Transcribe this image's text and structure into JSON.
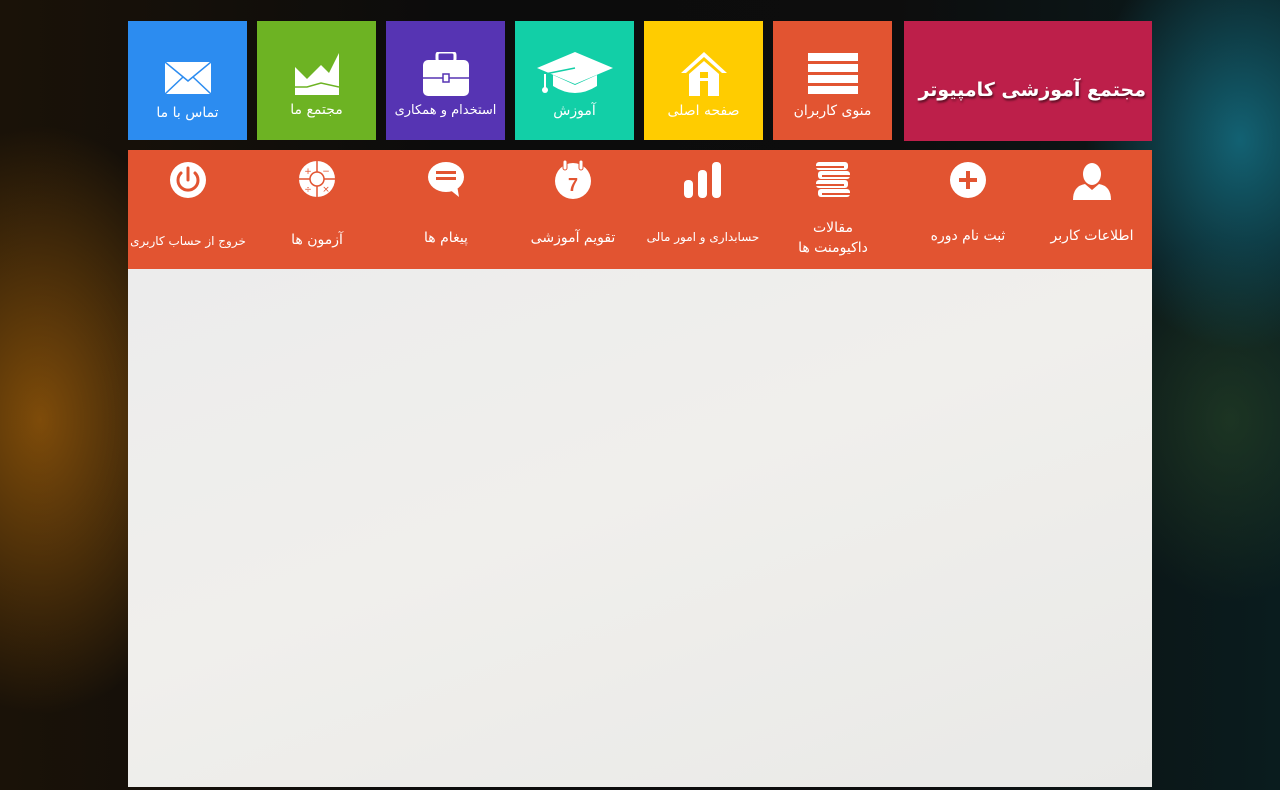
{
  "brand": {
    "title": "مجتمع آموزشی کامپیوتر",
    "color": "#bd1f4a"
  },
  "tiles": [
    {
      "label": "منوی کاربران",
      "icon": "hamburger-menu-icon",
      "color": "#e25431"
    },
    {
      "label": "صفحه اصلی",
      "icon": "home-icon",
      "color": "#ffcc00"
    },
    {
      "label": "آموزش",
      "icon": "graduation-cap-icon",
      "color": "#12cfa7"
    },
    {
      "label": "استخدام و همکاری",
      "icon": "briefcase-icon",
      "color": "#5634b3"
    },
    {
      "label": "مجتمع ما",
      "icon": "area-chart-icon",
      "color": "#6db323"
    },
    {
      "label": "تماس با ما",
      "icon": "envelope-icon",
      "color": "#2c8cf0"
    }
  ],
  "menu": {
    "color": "#e25431",
    "items": [
      {
        "label": "اطلاعات کاربر",
        "icon": "user-icon"
      },
      {
        "label": "ثبت نام  دوره",
        "icon": "plus-circle-icon"
      },
      {
        "label": "مقالات",
        "label2": "داکیومنت ها",
        "icon": "books-icon"
      },
      {
        "label": "حسابداری و امور مالی",
        "icon": "bar-chart-icon"
      },
      {
        "label": "تقویم آموزشی",
        "icon": "calendar-icon",
        "day": "7"
      },
      {
        "label": "پیغام ها",
        "icon": "chat-bubble-icon"
      },
      {
        "label": "آزمون ها",
        "icon": "calculator-icon"
      },
      {
        "label": "خروج از حساب کاربری",
        "icon": "power-icon"
      }
    ]
  }
}
